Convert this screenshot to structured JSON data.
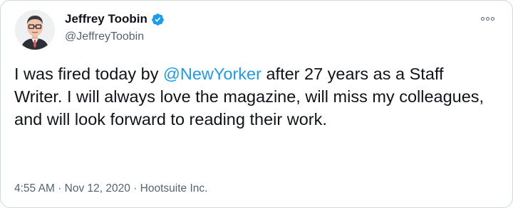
{
  "user": {
    "name": "Jeffrey Toobin",
    "handle": "@JeffreyToobin",
    "verified": true,
    "avatar": "avatar-icon"
  },
  "tweet": {
    "text_before": "I was fired today by ",
    "mention": "@NewYorker",
    "text_after": " after 27 years as a Staff Writer. I will always love the magazine, will miss my colleagues, and will look forward to reading their work."
  },
  "meta": {
    "time": "4:55 AM",
    "sep1": " · ",
    "date": "Nov 12, 2020",
    "sep2": " · ",
    "source": "Hootsuite Inc."
  },
  "colors": {
    "accent": "#1d9bf0",
    "text": "#0f1419",
    "secondary": "#536471",
    "border": "#cfd9de"
  },
  "icons": {
    "verified": "verified-badge-icon",
    "more": "more-options-icon"
  }
}
